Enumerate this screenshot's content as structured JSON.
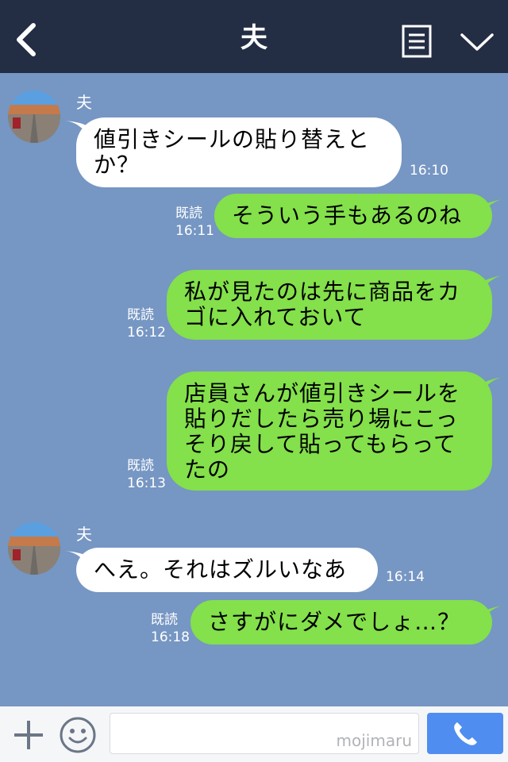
{
  "header": {
    "title": "夫"
  },
  "messages": [
    {
      "sender": "夫",
      "text": "値引きシールの貼り替えと\nか？",
      "time": "16:10"
    },
    {
      "text": "そういう手もあるのね",
      "read": "既読",
      "time": "16:11"
    },
    {
      "text": "私が見たのは先に商品をカ\nゴに入れておいて",
      "read": "既読",
      "time": "16:12"
    },
    {
      "text": "店員さんが値引きシールを\n貼りだしたら売り場にこっ\nそり戻して貼ってもらって\nたの",
      "read": "既読",
      "time": "16:13"
    },
    {
      "sender": "夫",
      "text": "へえ。それはズルいなあ",
      "time": "16:14"
    },
    {
      "text": "さすがにダメでしょ…？",
      "read": "既読",
      "time": "16:18"
    }
  ],
  "footer": {
    "watermark": "mojimaru"
  },
  "colors": {
    "header": "#232d44",
    "background": "#7696c3",
    "outgoing": "#84e04b",
    "incoming": "#ffffff",
    "call": "#4f8df0"
  },
  "icons": [
    "back-icon",
    "menu-icon",
    "chevron-down-icon",
    "plus-icon",
    "emoji-icon",
    "phone-icon"
  ]
}
